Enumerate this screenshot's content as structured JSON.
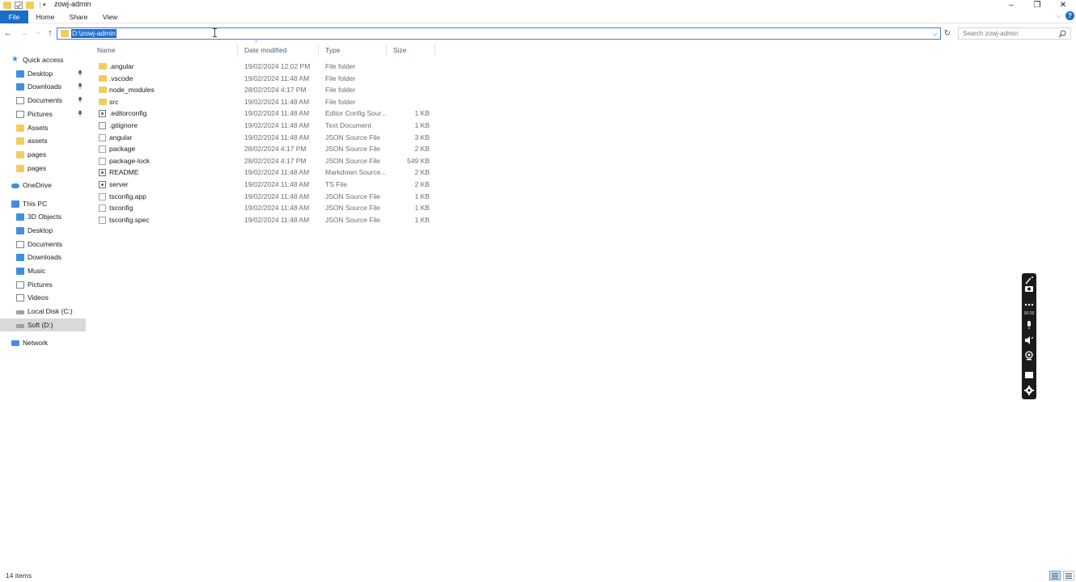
{
  "window": {
    "title": "zowj-admin",
    "controls": {
      "minimize": "–",
      "restore": "❐",
      "close": "✕"
    }
  },
  "ribbon": {
    "tabs": [
      "File",
      "Home",
      "Share",
      "View"
    ],
    "expand_glyph": "⌵",
    "help_glyph": "?"
  },
  "nav": {
    "back_glyph": "←",
    "forward_glyph": "→",
    "recent_glyph": "⌵",
    "up_glyph": "↑",
    "address": "D:\\zowj-admin",
    "address_drop": "⌵",
    "refresh_glyph": "↻",
    "search_placeholder": "Search zowj-admin"
  },
  "sidebar": {
    "items": [
      {
        "label": "Quick access",
        "icon": "star-icon",
        "indent": 0,
        "pinned": false
      },
      {
        "label": "Desktop",
        "icon": "desktop-icon",
        "indent": 1,
        "pinned": true
      },
      {
        "label": "Downloads",
        "icon": "download-icon",
        "indent": 1,
        "pinned": true
      },
      {
        "label": "Documents",
        "icon": "documents-icon",
        "indent": 1,
        "pinned": true
      },
      {
        "label": "Pictures",
        "icon": "pictures-icon",
        "indent": 1,
        "pinned": true
      },
      {
        "label": "Assets",
        "icon": "folder-icon",
        "indent": 1,
        "pinned": false
      },
      {
        "label": "assets",
        "icon": "folder-icon",
        "indent": 1,
        "pinned": false
      },
      {
        "label": "pages",
        "icon": "folder-icon",
        "indent": 1,
        "pinned": false
      },
      {
        "label": "pages",
        "icon": "folder-icon",
        "indent": 1,
        "pinned": false
      },
      {
        "label": "OneDrive",
        "icon": "cloud-icon",
        "indent": 0,
        "pinned": false
      },
      {
        "label": "This PC",
        "icon": "computer-icon",
        "indent": 0,
        "pinned": false
      },
      {
        "label": "3D Objects",
        "icon": "cube-icon",
        "indent": 1,
        "pinned": false
      },
      {
        "label": "Desktop",
        "icon": "desktop-icon",
        "indent": 1,
        "pinned": false
      },
      {
        "label": "Documents",
        "icon": "documents-icon",
        "indent": 1,
        "pinned": false
      },
      {
        "label": "Downloads",
        "icon": "download-icon",
        "indent": 1,
        "pinned": false
      },
      {
        "label": "Music",
        "icon": "music-icon",
        "indent": 1,
        "pinned": false
      },
      {
        "label": "Pictures",
        "icon": "pictures-icon",
        "indent": 1,
        "pinned": false
      },
      {
        "label": "Videos",
        "icon": "video-icon",
        "indent": 1,
        "pinned": false
      },
      {
        "label": "Local Disk (C:)",
        "icon": "drive-icon",
        "indent": 1,
        "pinned": false
      },
      {
        "label": "Soft (D:)",
        "icon": "drive-icon",
        "indent": 1,
        "pinned": false,
        "selected": true
      },
      {
        "label": "Network",
        "icon": "network-icon",
        "indent": 0,
        "pinned": false
      }
    ]
  },
  "table": {
    "headers": [
      "Name",
      "Date modified",
      "Type",
      "Size"
    ],
    "sort_glyph": "^",
    "rows": [
      {
        "name": ".angular",
        "date": "19/02/2024 12:02 PM",
        "type": "File folder",
        "size": "",
        "icon": "folder-icon"
      },
      {
        "name": ".vscode",
        "date": "19/02/2024 11:48 AM",
        "type": "File folder",
        "size": "",
        "icon": "folder-icon"
      },
      {
        "name": "node_modules",
        "date": "28/02/2024 4:17 PM",
        "type": "File folder",
        "size": "",
        "icon": "folder-icon"
      },
      {
        "name": "src",
        "date": "19/02/2024 11:48 AM",
        "type": "File folder",
        "size": "",
        "icon": "folder-icon"
      },
      {
        "name": ".editorconfig",
        "date": "19/02/2024 11:48 AM",
        "type": "Editor Config Sour...",
        "size": "1 KB",
        "icon": "config-file-icon"
      },
      {
        "name": ".gitignore",
        "date": "19/02/2024 11:48 AM",
        "type": "Text Document",
        "size": "1 KB",
        "icon": "text-file-icon"
      },
      {
        "name": "angular",
        "date": "19/02/2024 11:48 AM",
        "type": "JSON Source File",
        "size": "3 KB",
        "icon": "file-icon"
      },
      {
        "name": "package",
        "date": "28/02/2024 4:17 PM",
        "type": "JSON Source File",
        "size": "2 KB",
        "icon": "file-icon"
      },
      {
        "name": "package-lock",
        "date": "28/02/2024 4:17 PM",
        "type": "JSON Source File",
        "size": "549 KB",
        "icon": "file-icon"
      },
      {
        "name": "README",
        "date": "19/02/2024 11:48 AM",
        "type": "Markdown Source...",
        "size": "2 KB",
        "icon": "config-file-icon"
      },
      {
        "name": "server",
        "date": "19/02/2024 11:48 AM",
        "type": "TS File",
        "size": "2 KB",
        "icon": "config-file-icon"
      },
      {
        "name": "tsconfig.app",
        "date": "19/02/2024 11:48 AM",
        "type": "JSON Source File",
        "size": "1 KB",
        "icon": "file-icon"
      },
      {
        "name": "tsconfig",
        "date": "19/02/2024 11:48 AM",
        "type": "JSON Source File",
        "size": "1 KB",
        "icon": "file-icon"
      },
      {
        "name": "tsconfig.spec",
        "date": "19/02/2024 11:48 AM",
        "type": "JSON Source File",
        "size": "1 KB",
        "icon": "file-icon"
      }
    ]
  },
  "recorder": {
    "elapsed": "00:26"
  },
  "status": {
    "item_count": "14 items"
  },
  "colors": {
    "accent": "#1c6dc4",
    "selection": "#1f6fd4",
    "folder": "#f3cd5c"
  }
}
